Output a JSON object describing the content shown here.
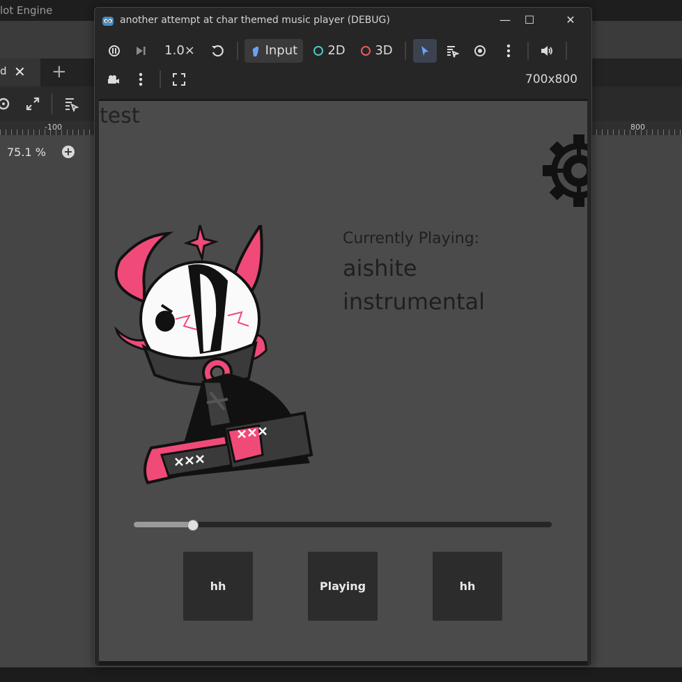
{
  "editor": {
    "title": "lot Engine",
    "tab_label": "d",
    "zoom": "75.1 %",
    "ruler": [
      "-100",
      "800"
    ]
  },
  "window": {
    "title": "another attempt at char themed music player (DEBUG)",
    "controls": {
      "minimize": "—",
      "maximize": "☐",
      "close": "✕"
    }
  },
  "toolbar": {
    "speed": "1.0×",
    "input_label": "Input",
    "mode_2d": "2D",
    "mode_3d": "3D",
    "resolution": "700x800",
    "colors": {
      "accent_blue": "#6aa2f7",
      "ring_2d": "#4fc7c2",
      "ring_3d": "#ef5a5a"
    }
  },
  "game": {
    "test_label": "test",
    "current_label": "Currently Playing:",
    "song_title": "aishite instrumental",
    "progress_percent": 14,
    "buttons": {
      "prev": "hh",
      "play": "Playing",
      "next": "hh"
    },
    "colors": {
      "character_pink": "#f04a78",
      "background": "#4b4b4b"
    }
  }
}
